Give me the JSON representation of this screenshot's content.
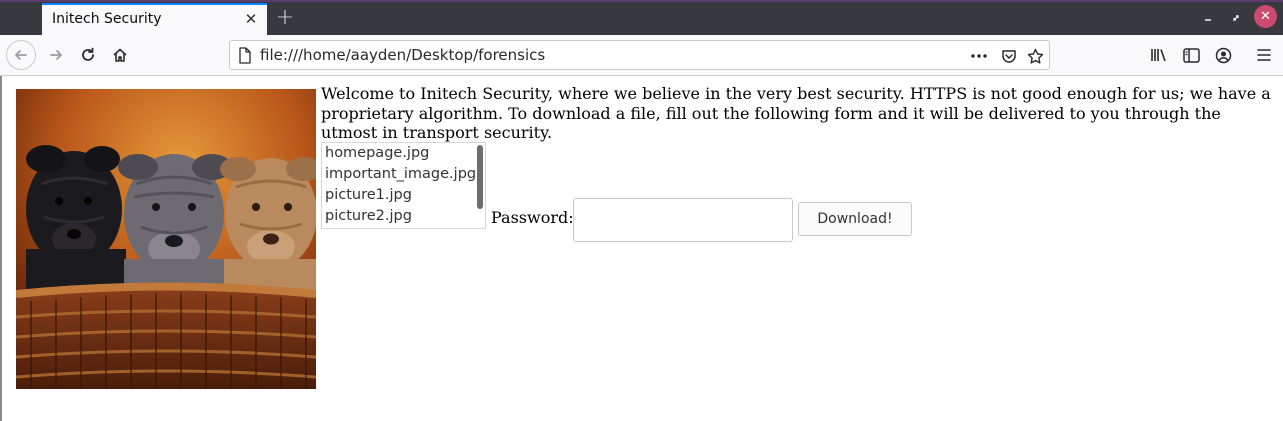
{
  "browser": {
    "tab_title": "Initech Security",
    "url": "file:///home/aayden/Desktop/forensics",
    "colors": {
      "tab_accent": "#0a84ff",
      "window_close": "#cc4a70",
      "titlebar": "#38393f"
    }
  },
  "page": {
    "intro_text": "Welcome to Initech Security, where we believe in the very best security. HTTPS is not good enough for us; we have a proprietary algorithm. To download a file, fill out the following form and it will be delivered to you through the utmost in transport security.",
    "files": [
      "homepage.jpg",
      "important_image.jpg",
      "picture1.jpg",
      "picture2.jpg"
    ],
    "password_label": "Password:",
    "password_value": "",
    "download_label": "Download!"
  }
}
